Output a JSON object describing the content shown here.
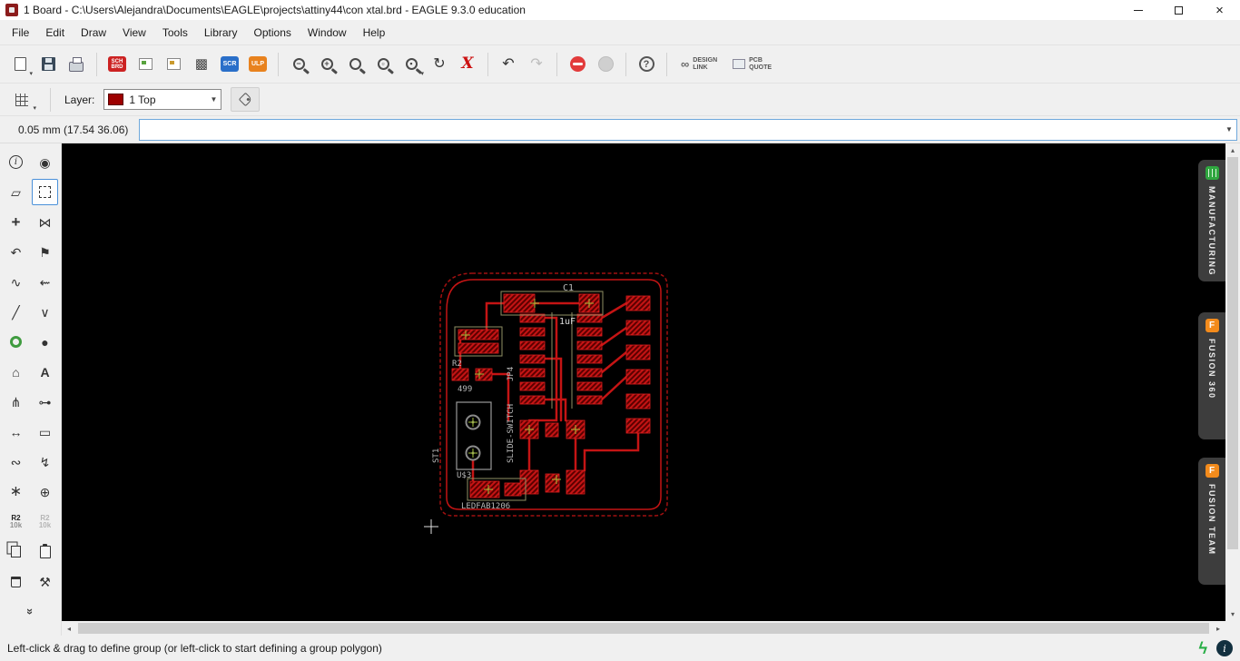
{
  "window": {
    "title": "1 Board - C:\\Users\\Alejandra\\Documents\\EAGLE\\projects\\attiny44\\con xtal.brd - EAGLE 9.3.0 education"
  },
  "menu": {
    "items": [
      "File",
      "Edit",
      "Draw",
      "View",
      "Tools",
      "Library",
      "Options",
      "Window",
      "Help"
    ]
  },
  "toolbar": {
    "sch_badge": "SCH",
    "brd_badge": "BRD",
    "scr_badge": "SCR",
    "ulp_badge": "ULP",
    "design_link_line1": "DESIGN",
    "design_link_line2": "LINK",
    "pcb_quote_line1": "PCB",
    "pcb_quote_line2": "QUOTE"
  },
  "layer_bar": {
    "label": "Layer:",
    "selected_layer": "1 Top",
    "layer_color": "#9d0000"
  },
  "command_bar": {
    "readout": "0.05 mm (17.54 36.06)",
    "command_value": ""
  },
  "palette": {
    "name_tool_label": "R2",
    "name_tool_value": "10k"
  },
  "right_tabs": {
    "manufacturing": "MANUFACTURING",
    "fusion360": "FUSION 360",
    "fusion_team": "FUSION TEAM"
  },
  "board": {
    "labels": {
      "c1_name": "C1",
      "c1_value": "1uF",
      "r2_name": "R2",
      "r2_value": "499",
      "u3_name": "U$3",
      "led_name": "LEDFAB1206",
      "jp4_name": "JP4",
      "switch_name": "SLIDE-SWITCH",
      "st1_name": "ST1"
    }
  },
  "status_bar": {
    "message": "Left-click & drag to define group (or left-click to start defining a group polygon)"
  }
}
